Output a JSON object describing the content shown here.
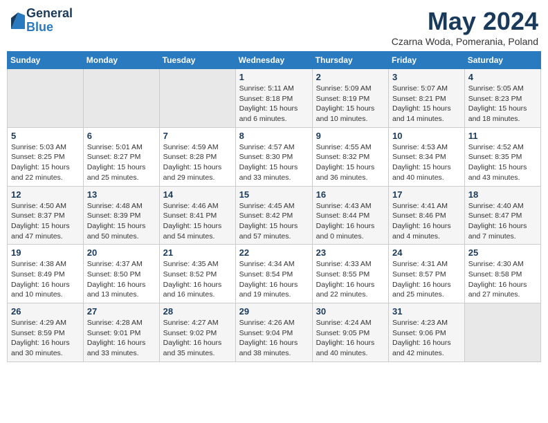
{
  "header": {
    "logo_general": "General",
    "logo_blue": "Blue",
    "month_title": "May 2024",
    "location": "Czarna Woda, Pomerania, Poland"
  },
  "weekdays": [
    "Sunday",
    "Monday",
    "Tuesday",
    "Wednesday",
    "Thursday",
    "Friday",
    "Saturday"
  ],
  "weeks": [
    [
      {
        "day": "",
        "info": ""
      },
      {
        "day": "",
        "info": ""
      },
      {
        "day": "",
        "info": ""
      },
      {
        "day": "1",
        "info": "Sunrise: 5:11 AM\nSunset: 8:18 PM\nDaylight: 15 hours\nand 6 minutes."
      },
      {
        "day": "2",
        "info": "Sunrise: 5:09 AM\nSunset: 8:19 PM\nDaylight: 15 hours\nand 10 minutes."
      },
      {
        "day": "3",
        "info": "Sunrise: 5:07 AM\nSunset: 8:21 PM\nDaylight: 15 hours\nand 14 minutes."
      },
      {
        "day": "4",
        "info": "Sunrise: 5:05 AM\nSunset: 8:23 PM\nDaylight: 15 hours\nand 18 minutes."
      }
    ],
    [
      {
        "day": "5",
        "info": "Sunrise: 5:03 AM\nSunset: 8:25 PM\nDaylight: 15 hours\nand 22 minutes."
      },
      {
        "day": "6",
        "info": "Sunrise: 5:01 AM\nSunset: 8:27 PM\nDaylight: 15 hours\nand 25 minutes."
      },
      {
        "day": "7",
        "info": "Sunrise: 4:59 AM\nSunset: 8:28 PM\nDaylight: 15 hours\nand 29 minutes."
      },
      {
        "day": "8",
        "info": "Sunrise: 4:57 AM\nSunset: 8:30 PM\nDaylight: 15 hours\nand 33 minutes."
      },
      {
        "day": "9",
        "info": "Sunrise: 4:55 AM\nSunset: 8:32 PM\nDaylight: 15 hours\nand 36 minutes."
      },
      {
        "day": "10",
        "info": "Sunrise: 4:53 AM\nSunset: 8:34 PM\nDaylight: 15 hours\nand 40 minutes."
      },
      {
        "day": "11",
        "info": "Sunrise: 4:52 AM\nSunset: 8:35 PM\nDaylight: 15 hours\nand 43 minutes."
      }
    ],
    [
      {
        "day": "12",
        "info": "Sunrise: 4:50 AM\nSunset: 8:37 PM\nDaylight: 15 hours\nand 47 minutes."
      },
      {
        "day": "13",
        "info": "Sunrise: 4:48 AM\nSunset: 8:39 PM\nDaylight: 15 hours\nand 50 minutes."
      },
      {
        "day": "14",
        "info": "Sunrise: 4:46 AM\nSunset: 8:41 PM\nDaylight: 15 hours\nand 54 minutes."
      },
      {
        "day": "15",
        "info": "Sunrise: 4:45 AM\nSunset: 8:42 PM\nDaylight: 15 hours\nand 57 minutes."
      },
      {
        "day": "16",
        "info": "Sunrise: 4:43 AM\nSunset: 8:44 PM\nDaylight: 16 hours\nand 0 minutes."
      },
      {
        "day": "17",
        "info": "Sunrise: 4:41 AM\nSunset: 8:46 PM\nDaylight: 16 hours\nand 4 minutes."
      },
      {
        "day": "18",
        "info": "Sunrise: 4:40 AM\nSunset: 8:47 PM\nDaylight: 16 hours\nand 7 minutes."
      }
    ],
    [
      {
        "day": "19",
        "info": "Sunrise: 4:38 AM\nSunset: 8:49 PM\nDaylight: 16 hours\nand 10 minutes."
      },
      {
        "day": "20",
        "info": "Sunrise: 4:37 AM\nSunset: 8:50 PM\nDaylight: 16 hours\nand 13 minutes."
      },
      {
        "day": "21",
        "info": "Sunrise: 4:35 AM\nSunset: 8:52 PM\nDaylight: 16 hours\nand 16 minutes."
      },
      {
        "day": "22",
        "info": "Sunrise: 4:34 AM\nSunset: 8:54 PM\nDaylight: 16 hours\nand 19 minutes."
      },
      {
        "day": "23",
        "info": "Sunrise: 4:33 AM\nSunset: 8:55 PM\nDaylight: 16 hours\nand 22 minutes."
      },
      {
        "day": "24",
        "info": "Sunrise: 4:31 AM\nSunset: 8:57 PM\nDaylight: 16 hours\nand 25 minutes."
      },
      {
        "day": "25",
        "info": "Sunrise: 4:30 AM\nSunset: 8:58 PM\nDaylight: 16 hours\nand 27 minutes."
      }
    ],
    [
      {
        "day": "26",
        "info": "Sunrise: 4:29 AM\nSunset: 8:59 PM\nDaylight: 16 hours\nand 30 minutes."
      },
      {
        "day": "27",
        "info": "Sunrise: 4:28 AM\nSunset: 9:01 PM\nDaylight: 16 hours\nand 33 minutes."
      },
      {
        "day": "28",
        "info": "Sunrise: 4:27 AM\nSunset: 9:02 PM\nDaylight: 16 hours\nand 35 minutes."
      },
      {
        "day": "29",
        "info": "Sunrise: 4:26 AM\nSunset: 9:04 PM\nDaylight: 16 hours\nand 38 minutes."
      },
      {
        "day": "30",
        "info": "Sunrise: 4:24 AM\nSunset: 9:05 PM\nDaylight: 16 hours\nand 40 minutes."
      },
      {
        "day": "31",
        "info": "Sunrise: 4:23 AM\nSunset: 9:06 PM\nDaylight: 16 hours\nand 42 minutes."
      },
      {
        "day": "",
        "info": ""
      }
    ]
  ]
}
